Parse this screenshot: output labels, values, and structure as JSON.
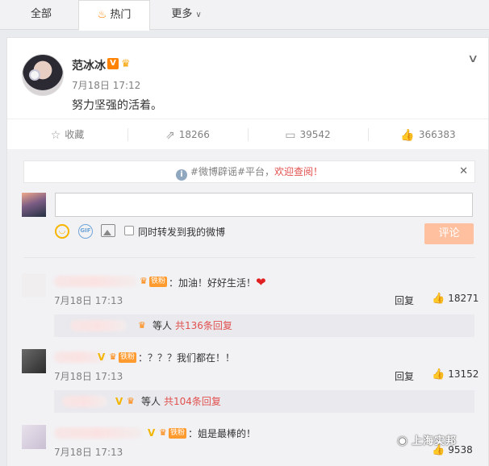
{
  "tabs": {
    "all": "全部",
    "hot": "热门",
    "more": "更多"
  },
  "post": {
    "author": "范冰冰",
    "time": "7月18日 17:12",
    "text": "努力坚强的活着。",
    "actions": {
      "favorite": "收藏",
      "repost": "18266",
      "comment": "39542",
      "like": "366383"
    }
  },
  "notice": {
    "tag": "#微博辟谣#平台，",
    "text": "欢迎查阅！"
  },
  "composer": {
    "placeholder": "",
    "repost_checkbox_label": "同时转发到我的微博",
    "submit_label": "评论"
  },
  "comments": [
    {
      "text": "：加油！好好生活！",
      "time": "7月18日 17:13",
      "reply_label": "回复",
      "likes": "18271",
      "replies_prefix": "等人",
      "replies_count": "共136条回复",
      "fan_badge": "铁粉"
    },
    {
      "text": "：？？？我们都在！！",
      "time": "7月18日 17:13",
      "reply_label": "回复",
      "likes": "13152",
      "replies_prefix": "等人",
      "replies_count": "共104条回复",
      "fan_badge": "铁粉"
    },
    {
      "text": "：姐是最棒的！",
      "time": "7月18日 17:13",
      "reply_label": "回复",
      "likes": "9538",
      "fan_badge": "铁粉"
    }
  ],
  "watermark": "上海实邦",
  "colors": {
    "accent": "#ff8200",
    "link_red": "#e2504d",
    "button_disabled": "#ffc09f"
  }
}
